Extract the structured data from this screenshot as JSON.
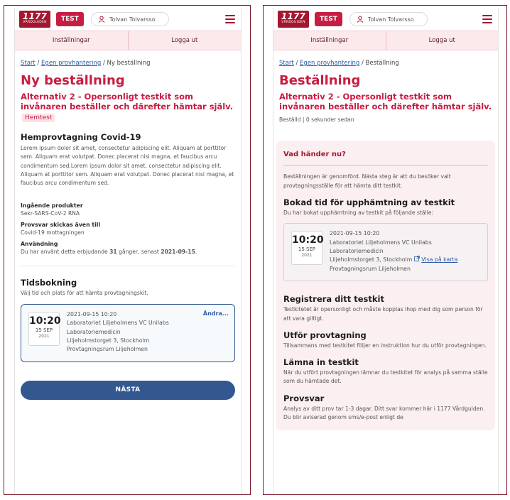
{
  "header": {
    "logo_number": "1177",
    "logo_sub": "VÅRDGUIDEN",
    "test_badge": "TEST",
    "user_name": "Tolvan Tolvarsso",
    "subnav_settings": "Inställningar",
    "subnav_logout": "Logga ut"
  },
  "left": {
    "breadcrumb": {
      "start": "Start",
      "sep1": "/",
      "self_service": "Egen provhantering",
      "sep2": "/",
      "current": "Ny beställning"
    },
    "title": "Ny beställning",
    "subtitle": "Alternativ 2 - Opersonligt testkit som invånaren beställer och därefter hämtar själv.",
    "tag": "Hemtest",
    "section_title": "Hemprovtagning Covid-19",
    "lorem": "Lorem ipsum dolor sit amet, consectetur adipiscing elit. Aliquam at porttitor sem. Aliquam erat volutpat. Donec placerat nisl magna, et faucibus arcu condimentum sed.Lorem ipsum dolor sit amet, consectetur adipiscing elit. Aliquam at porttitor sem. Aliquam erat volutpat. Donec placerat nisl magna, et faucibus arcu condimentum sed.",
    "products_label": "Ingående produkter",
    "products_value": "Sekr-SARS-CoV-2 RNA",
    "reply_label": "Provsvar skickas även till",
    "reply_value": "Covid-19 mottagningen",
    "usage_label": "Användning",
    "usage_pre": "Du har använt detta erbjudande ",
    "usage_count": "31",
    "usage_mid": " gånger, senast ",
    "usage_date": "2021-09-15",
    "usage_post": ".",
    "booking_title": "Tidsbokning",
    "booking_desc": "Välj tid och plats för att hämta provtagningskit.",
    "change_link": "Ändra...",
    "next_button": "NÄSTA"
  },
  "booking": {
    "time": "10:20",
    "day_month": "15 SEP",
    "year": "2021",
    "datetime": "2021-09-15 10:20",
    "lab": "Laboratoriet Liljeholmens VC Unilabs",
    "dept": "Laboratoriemedicin",
    "address": "Liljeholmstorget 3, Stockholm",
    "room": "Provtagningsrum Liljeholmen"
  },
  "right": {
    "breadcrumb": {
      "start": "Start",
      "sep1": "/",
      "self_service": "Egen provhantering",
      "sep2": "/",
      "current": "Beställning"
    },
    "title": "Beställning",
    "subtitle": "Alternativ 2 - Opersonligt testkit som invånaren beställer och därefter hämtar själv.",
    "status": "Beställd | 0 sekunder sedan",
    "what_next_title": "Vad händer nu?",
    "what_next_text": "Beställningen är genomförd. Nästa steg är att du besöker valt provtagningsställe för att hämta ditt testkit.",
    "booked_title": "Bokad tid för upphämtning av testkit",
    "booked_text": "Du har bokat upphämtning av testkit på följande ställe:",
    "map_link": "Visa på karta",
    "register_title": "Registrera ditt testkit",
    "register_text": "Testkitetet är opersonligt och måste kopplas ihop med dig som person för att vara giltigt.",
    "perform_title": "Utför provtagning",
    "perform_text": "Tillsammans med testkitet följer en instruktion hur du utför provtagningen.",
    "submit_title": "Lämna in testkit",
    "submit_text": "När du utfört provtagningen lämnar du testkitet för analys på samma ställe som du hämtade det.",
    "result_title": "Provsvar",
    "result_text": "Analys av ditt prov tar 1-3 dagar. Ditt svar kommer här i 1177 Vårdguiden. Du blir aviserad genom sms/e-post enligt de"
  }
}
